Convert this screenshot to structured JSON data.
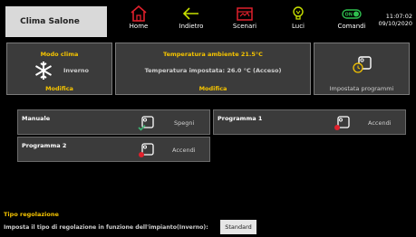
{
  "header": {
    "room_title": "Clima Salone",
    "nav": [
      {
        "label": "Home",
        "icon": "home-icon"
      },
      {
        "label": "Indietro",
        "icon": "back-arrow-icon"
      },
      {
        "label": "Scenari",
        "icon": "scenes-icon"
      },
      {
        "label": "Luci",
        "icon": "lightbulb-icon"
      },
      {
        "label": "Comandi",
        "icon": "toggle-switch-icon",
        "badge": "ON"
      }
    ],
    "time": "11:07:02",
    "date": "09/10/2020"
  },
  "mode_panel": {
    "title": "Modo clima",
    "mode": "Inverno",
    "action": "Modifica",
    "icon": "snowflake-icon"
  },
  "temp_panel": {
    "ambient": "Temperatura ambiente 21.5°C",
    "set": "Temperatura impostata: 26.0 °C (Acceso)",
    "action": "Modifica"
  },
  "program_panel": {
    "label": "Impostata programmi",
    "icon": "thermostat-clock-icon"
  },
  "programs": [
    {
      "name": "Manuale",
      "action": "Spegni",
      "status": "active"
    },
    {
      "name": "Programma 1",
      "action": "Accendi",
      "status": "inactive"
    },
    {
      "name": "Programma 2",
      "action": "Accendi",
      "status": "inactive"
    }
  ],
  "regulation": {
    "title": "Tipo regolazione",
    "description": "Imposta il tipo di regolazione in funzione dell'impianto(Inverno):",
    "value": "Standard"
  },
  "colors": {
    "accent": "#f5c400",
    "alert": "#e0202c",
    "ok": "#3cb371",
    "panel": "#3b3b3b"
  }
}
